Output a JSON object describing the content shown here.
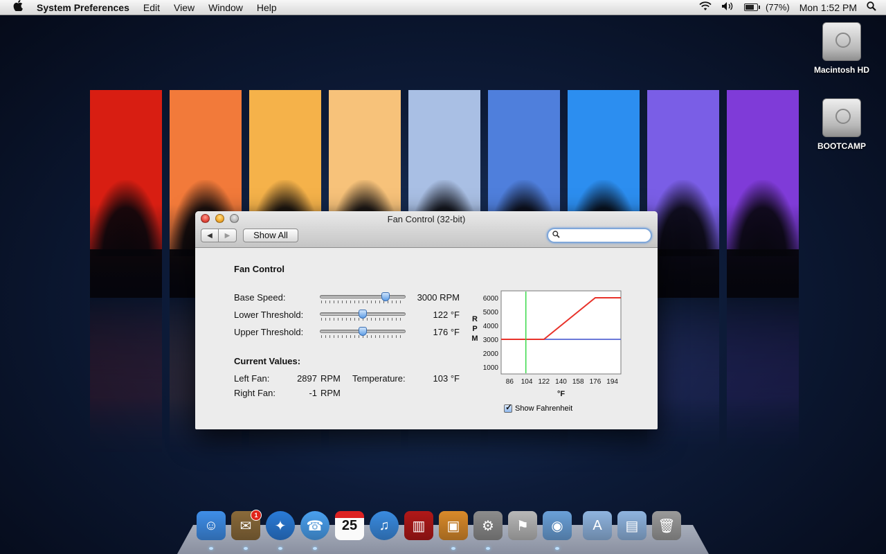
{
  "menubar": {
    "app_name": "System Preferences",
    "items": [
      "Edit",
      "View",
      "Window",
      "Help"
    ],
    "battery": "(77%)",
    "battery_level": 0.77,
    "clock": "Mon 1:52 PM"
  },
  "desktop": {
    "icons": [
      {
        "label": "Macintosh HD"
      },
      {
        "label": "BOOTCAMP"
      }
    ],
    "strip_colors": [
      "#d81e12",
      "#f27a3a",
      "#f5b24a",
      "#f7c27a",
      "#a9bfe4",
      "#4f7fdc",
      "#2c8ef0",
      "#7a5ee6",
      "#7f3bd8"
    ]
  },
  "window": {
    "title": "Fan Control (32-bit)",
    "show_all": "Show All",
    "search_placeholder": "",
    "section_title": "Fan Control",
    "controls": [
      {
        "label": "Base Speed:",
        "value": "3000 RPM",
        "position": 0.77
      },
      {
        "label": "Lower Threshold:",
        "value": "122 °F",
        "position": 0.5
      },
      {
        "label": "Upper Threshold:",
        "value": "176 °F",
        "position": 0.5
      }
    ],
    "current_title": "Current Values:",
    "left_fan_label": "Left Fan:",
    "left_fan_value": "2897",
    "left_fan_unit": "RPM",
    "right_fan_label": "Right Fan:",
    "right_fan_value": "-1",
    "right_fan_unit": "RPM",
    "temp_label": "Temperature:",
    "temp_value": "103 °F",
    "show_fahrenheit": "Show Fahrenheit",
    "show_fahrenheit_checked": true
  },
  "chart_data": {
    "type": "line",
    "xlabel": "°F",
    "ylabel": "RPM",
    "xlim": [
      77,
      203
    ],
    "ylim": [
      500,
      6500
    ],
    "x_ticks": [
      86,
      104,
      122,
      140,
      158,
      176,
      194
    ],
    "y_ticks": [
      1000,
      2000,
      3000,
      4000,
      5000,
      6000
    ],
    "current_temperature": 103,
    "base_speed": 3000,
    "series": [
      {
        "color": "#e8322a",
        "x": [
          77,
          122,
          176,
          203
        ],
        "y": [
          3000,
          3000,
          6000,
          6000
        ]
      },
      {
        "color": "#6b79d9",
        "x": [
          77,
          203
        ],
        "y": [
          3000,
          3000
        ]
      }
    ],
    "marker_color": "#3ad94a",
    "grid": false
  },
  "dock": {
    "items": [
      {
        "icon": "finder-icon",
        "color": "#3f8ee8",
        "glyph": "☺"
      },
      {
        "icon": "mail-icon",
        "color": "#8a6a3a",
        "glyph": "✉",
        "badge": "1"
      },
      {
        "icon": "safari-icon",
        "color": "#2a7bd8",
        "glyph": "✦"
      },
      {
        "icon": "ichat-icon",
        "color": "#4aa0ef",
        "glyph": "☎"
      },
      {
        "icon": "ical-icon",
        "color": "#f2f2f2",
        "glyph": "25"
      },
      {
        "icon": "itunes-icon",
        "color": "#3a8be0",
        "glyph": "♫"
      },
      {
        "icon": "front-row-icon",
        "color": "#b01818",
        "glyph": "▥"
      },
      {
        "icon": "iphoto-icon",
        "color": "#d98a2a",
        "glyph": "▣"
      },
      {
        "icon": "system-preferences-icon",
        "color": "#8c8c8c",
        "glyph": "⚙"
      },
      {
        "icon": "utility-icon",
        "color": "#b8b8b8",
        "glyph": "⚑"
      },
      {
        "icon": "preview-icon",
        "color": "#6aa0d8",
        "glyph": "◉"
      },
      {
        "icon": "applications-folder-icon",
        "color": "#8fb4df",
        "glyph": "A"
      },
      {
        "icon": "documents-folder-icon",
        "color": "#8fb4df",
        "glyph": "▤"
      },
      {
        "icon": "trash-icon",
        "color": "#9a9a9a",
        "glyph": "🗑"
      }
    ]
  }
}
